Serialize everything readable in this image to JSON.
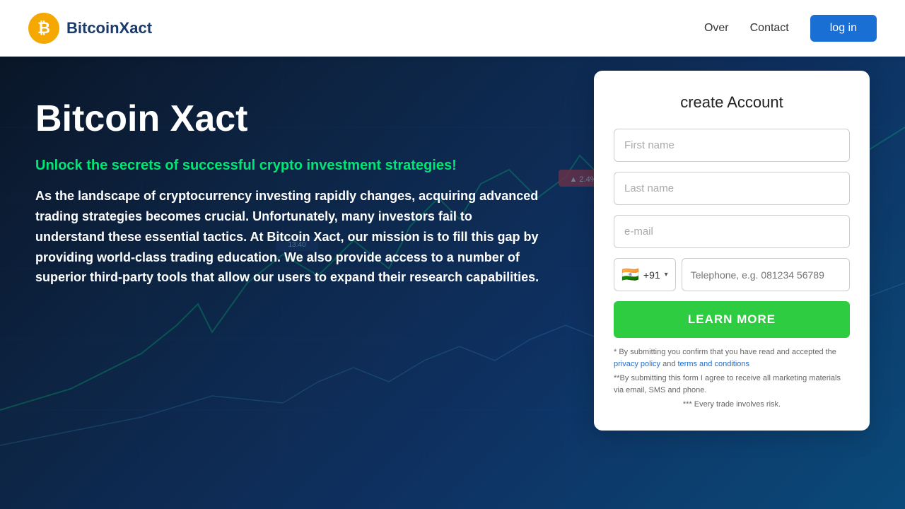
{
  "navbar": {
    "logo_text": "BitcoinXact",
    "nav_links": [
      "Over",
      "Contact"
    ],
    "login_label": "log in"
  },
  "hero": {
    "title": "Bitcoin Xact",
    "subtitle": "Unlock the secrets of successful crypto investment strategies!",
    "body": "As the landscape of cryptocurrency investing rapidly changes, acquiring advanced trading strategies becomes crucial. Unfortunately, many investors fail to understand these essential tactics. At Bitcoin Xact, our mission is to fill this gap by providing world-class trading education. We also provide access to a number of superior third-party tools that allow our users to expand their research capabilities."
  },
  "form": {
    "title": "create Account",
    "first_name_placeholder": "First name",
    "last_name_placeholder": "Last name",
    "email_placeholder": "e-mail",
    "phone_flag": "🇮🇳",
    "phone_code": "+91",
    "phone_placeholder": "Telephone, e.g. 081234 56789",
    "cta_label": "LEARN MORE",
    "disclaimer_line1": "* By submitting you confirm that you have read and accepted the ",
    "privacy_policy_label": "privacy policy",
    "disclaimer_and": " and ",
    "terms_label": "terms and conditions",
    "disclaimer_line2": "**By submitting this form I agree to receive all marketing materials via email, SMS and phone.",
    "disclaimer_line3": "*** Every trade involves risk."
  },
  "colors": {
    "brand_blue": "#1a6fd4",
    "hero_green": "#2ecc40",
    "logo_gold": "#f4a800"
  }
}
